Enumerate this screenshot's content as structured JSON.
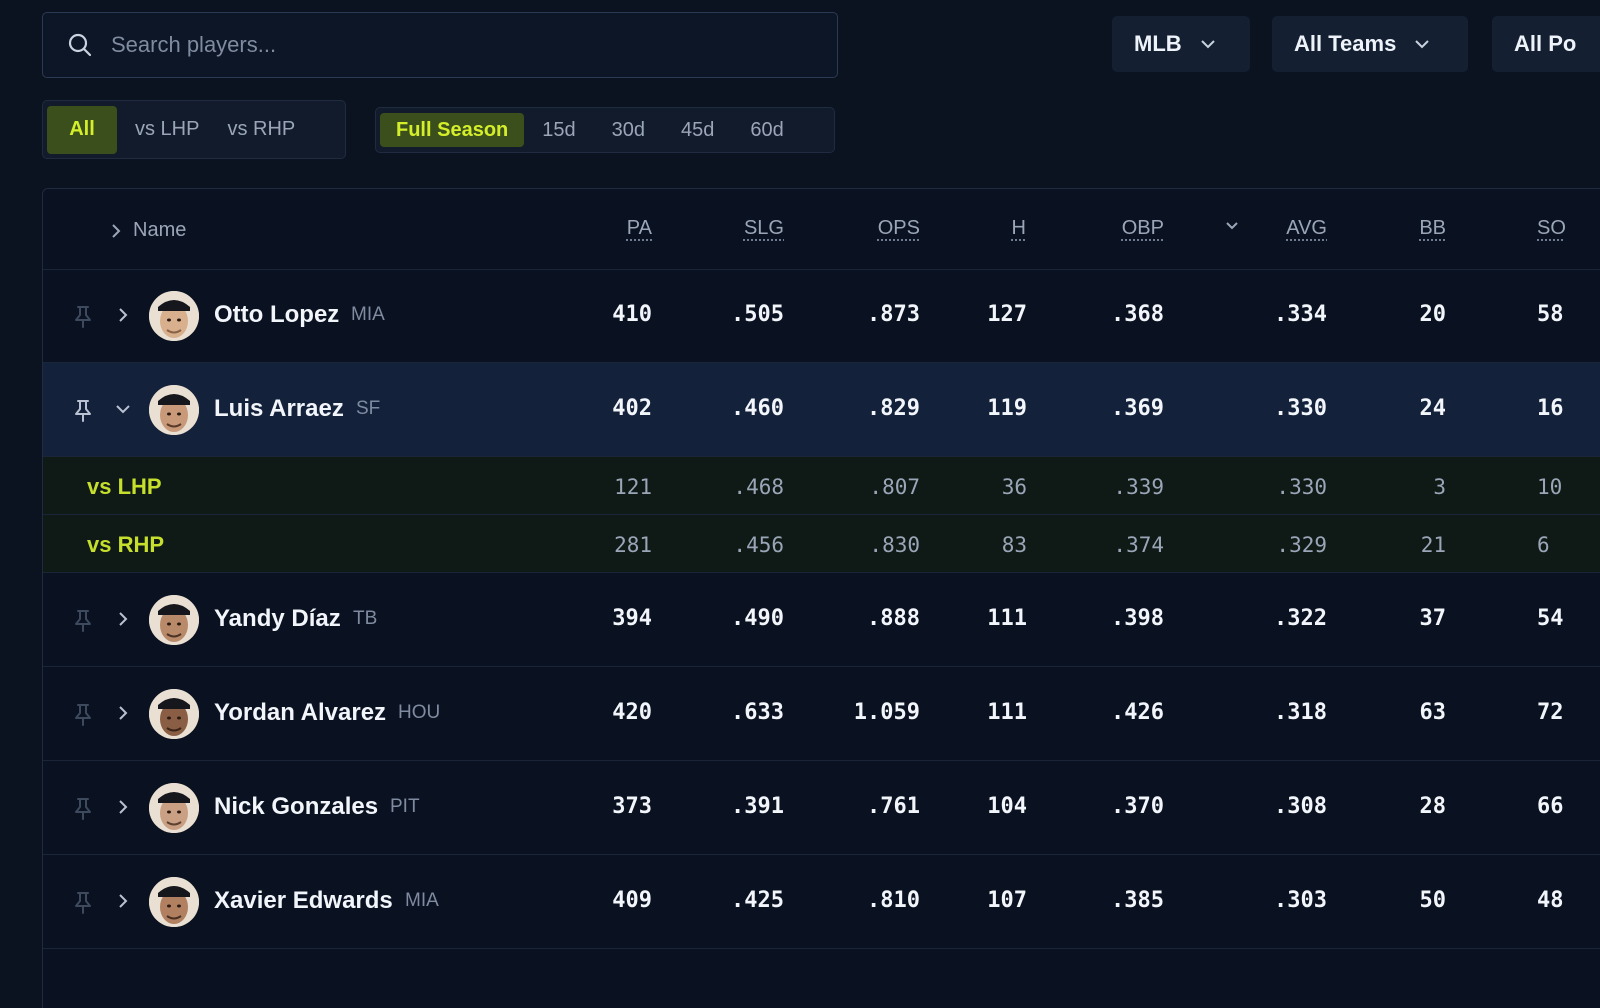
{
  "search": {
    "placeholder": "Search players..."
  },
  "filters": {
    "league": "MLB",
    "team": "All Teams",
    "position": "All Po"
  },
  "handedness_tabs": [
    {
      "label": "All",
      "active": true
    },
    {
      "label": "vs LHP",
      "active": false
    },
    {
      "label": "vs RHP",
      "active": false
    }
  ],
  "period_tabs": [
    {
      "label": "Full Season",
      "active": true
    },
    {
      "label": "15d",
      "active": false
    },
    {
      "label": "30d",
      "active": false
    },
    {
      "label": "45d",
      "active": false
    },
    {
      "label": "60d",
      "active": false
    }
  ],
  "table": {
    "name_header": "Name",
    "columns": [
      "PA",
      "SLG",
      "OPS",
      "H",
      "OBP",
      "AVG",
      "BB",
      "SO"
    ],
    "sort_indicator": "chevron-down",
    "rows": [
      {
        "name": "Otto Lopez",
        "team": "MIA",
        "stats": [
          "410",
          ".505",
          ".873",
          "127",
          ".368",
          ".334",
          "20",
          "58"
        ]
      },
      {
        "name": "Luis Arraez",
        "team": "SF",
        "stats": [
          "402",
          ".460",
          ".829",
          "119",
          ".369",
          ".330",
          "24",
          "16"
        ],
        "expanded": true
      },
      {
        "split": "vs LHP",
        "stats": [
          "121",
          ".468",
          ".807",
          "36",
          ".339",
          ".330",
          "3",
          "10"
        ]
      },
      {
        "split": "vs RHP",
        "stats": [
          "281",
          ".456",
          ".830",
          "83",
          ".374",
          ".329",
          "21",
          "6"
        ]
      },
      {
        "name": "Yandy Díaz",
        "team": "TB",
        "stats": [
          "394",
          ".490",
          ".888",
          "111",
          ".398",
          ".322",
          "37",
          "54"
        ]
      },
      {
        "name": "Yordan Alvarez",
        "team": "HOU",
        "stats": [
          "420",
          ".633",
          "1.059",
          "111",
          ".426",
          ".318",
          "63",
          "72"
        ]
      },
      {
        "name": "Nick Gonzales",
        "team": "PIT",
        "stats": [
          "373",
          ".391",
          ".761",
          "104",
          ".370",
          ".308",
          "28",
          "66"
        ]
      },
      {
        "name": "Xavier Edwards",
        "team": "MIA",
        "stats": [
          "409",
          ".425",
          ".810",
          "107",
          ".385",
          ".303",
          "50",
          "48"
        ]
      }
    ]
  },
  "colors": {
    "background": "#0b1220",
    "accent": "#d4ee2a",
    "active_tab_bg": "#3b4f1c",
    "expanded_row": "#14213a"
  }
}
